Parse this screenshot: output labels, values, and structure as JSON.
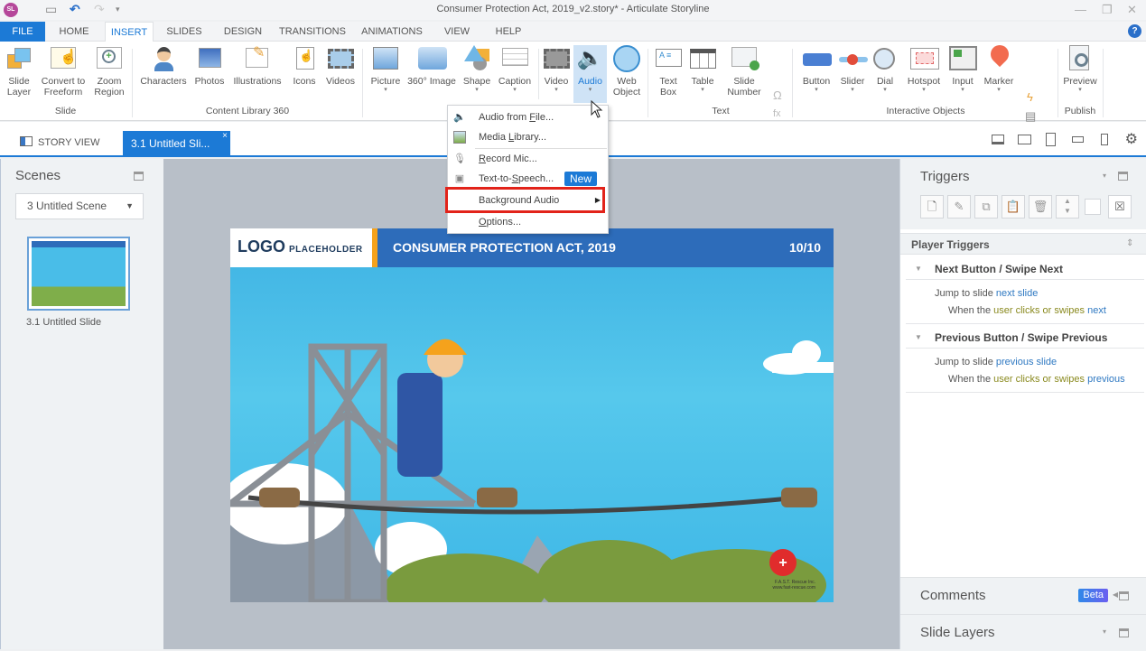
{
  "titlebar": {
    "app_icon": "SL",
    "title": "Consumer Protection Act, 2019_v2.story* -  Articulate Storyline",
    "quick_access": [
      "save-icon",
      "undo-icon",
      "redo-icon",
      "customize-icon"
    ],
    "window_controls": {
      "minimize": "—",
      "restore": "❐",
      "close": "✕"
    }
  },
  "ribbon_tabs": [
    "FILE",
    "HOME",
    "INSERT",
    "SLIDES",
    "DESIGN",
    "TRANSITIONS",
    "ANIMATIONS",
    "VIEW",
    "HELP"
  ],
  "active_tab": "INSERT",
  "ribbon": {
    "groups": [
      {
        "label": "Slide",
        "buttons": [
          "Slide Layer",
          "Convert to Freeform",
          "Zoom Region"
        ]
      },
      {
        "label": "Content Library 360",
        "buttons": [
          "Characters",
          "Photos",
          "Illustrations",
          "Icons",
          "Videos"
        ]
      },
      {
        "label": "",
        "buttons": [
          "Picture",
          "360° Image",
          "Shape",
          "Caption"
        ]
      },
      {
        "label": "",
        "buttons": [
          "Video",
          "Audio",
          "Web Object"
        ]
      },
      {
        "label": "Text",
        "buttons": [
          "Text Box",
          "Table",
          "Slide Number"
        ]
      },
      {
        "label": "Interactive Objects",
        "buttons": [
          "Button",
          "Slider",
          "Dial",
          "Hotspot",
          "Input",
          "Marker"
        ]
      },
      {
        "label": "Publish",
        "buttons": [
          "Preview"
        ]
      }
    ],
    "btn": {
      "slide_layer": [
        "Slide",
        "Layer"
      ],
      "convert": [
        "Convert to",
        "Freeform"
      ],
      "zoom": [
        "Zoom",
        "Region"
      ],
      "characters": "Characters",
      "photos": "Photos",
      "illustrations": "Illustrations",
      "icons": "Icons",
      "videos": "Videos",
      "picture": "Picture",
      "image360": "360° Image",
      "shape": "Shape",
      "caption": "Caption",
      "video": "Video",
      "audio": "Audio",
      "web": [
        "Web",
        "Object"
      ],
      "textbox": [
        "Text",
        "Box"
      ],
      "table": "Table",
      "slidenum": [
        "Slide",
        "Number"
      ],
      "button": "Button",
      "slider": "Slider",
      "dial": "Dial",
      "hotspot": "Hotspot",
      "input": "Input",
      "marker": "Marker",
      "preview": "Preview"
    },
    "group_labels": {
      "slide": "Slide",
      "content": "Content Library 360",
      "text": "Text",
      "interactive": "Interactive Objects",
      "publish": "Publish"
    }
  },
  "audio_menu": {
    "items": [
      {
        "label_pre": "Audio from ",
        "label_u": "F",
        "label_post": "ile...",
        "icon": "audio-file-icon"
      },
      {
        "label_pre": "Media ",
        "label_u": "L",
        "label_post": "ibrary...",
        "icon": "media-library-icon"
      },
      {
        "label_pre": "",
        "label_u": "R",
        "label_post": "ecord Mic...",
        "icon": "microphone-icon"
      },
      {
        "label_pre": "Text-to-",
        "label_u": "S",
        "label_post": "peech...",
        "icon": "text-to-speech-icon",
        "badge": "New"
      },
      {
        "label_pre": "Background Audio",
        "label_u": "",
        "label_post": "",
        "submenu": true,
        "highlighted": true
      },
      {
        "label_pre": "",
        "label_u": "O",
        "label_post": "ptions..."
      }
    ]
  },
  "doc_tabs": {
    "story_view": "STORY VIEW",
    "slide_tab": "3.1 Untitled Sli..."
  },
  "scenes_panel": {
    "title": "Scenes",
    "selected_scene": "3 Untitled Scene",
    "slides": [
      {
        "label": "3.1 Untitled Slide"
      }
    ]
  },
  "slide": {
    "logo": "LOGO",
    "logo_sub": "PLACEHOLDER",
    "title": "CONSUMER PROTECTION ACT, 2019",
    "page": "10/10",
    "watermark_line1": "F.A.S.T. Rescue Inc.",
    "watermark_line2": "www.fast-rescue.com"
  },
  "triggers_panel": {
    "title": "Triggers",
    "section": "Player Triggers",
    "triggers": [
      {
        "name": "Next Button / Swipe Next",
        "action": "Jump to slide",
        "target": "next slide",
        "when": "When the",
        "event": "user clicks or swipes",
        "object": "next"
      },
      {
        "name": "Previous Button / Swipe Previous",
        "action": "Jump to slide",
        "target": "previous slide",
        "when": "When the",
        "event": "user clicks or swipes",
        "object": "previous"
      }
    ]
  },
  "comments_panel": {
    "title": "Comments",
    "badge": "Beta"
  },
  "slide_layers_panel": {
    "title": "Slide Layers"
  },
  "colors": {
    "accent": "#1c7ad6",
    "highlight_box": "#e2231a",
    "slide_header": "#2d6cba",
    "logo_bar": "#f5a21c"
  }
}
